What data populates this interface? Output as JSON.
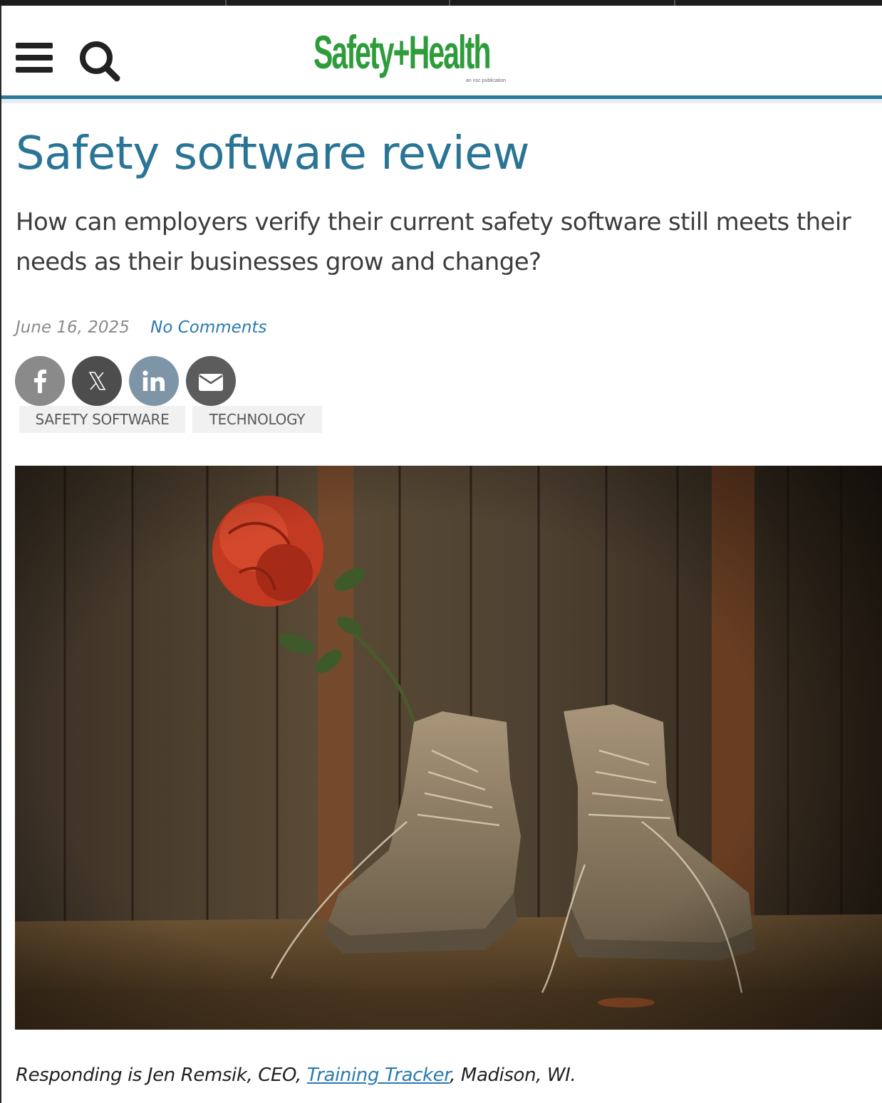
{
  "header": {
    "logo_text": "Safety+Health",
    "logo_subtitle": "an nsc publication"
  },
  "article": {
    "title": "Safety software review",
    "dek": "How can employers verify their current safety software still meets their needs as their businesses grow and change?",
    "date": "June 16, 2025",
    "comments_label": "No Comments",
    "tags": [
      "SAFETY SOFTWARE",
      "TECHNOLOGY"
    ],
    "caption": {
      "prefix": "Responding is Jen Remsik, CEO, ",
      "link_text": "Training Tracker",
      "suffix": ", Madison, WI."
    }
  },
  "share": [
    {
      "name": "facebook",
      "icon": "facebook-icon",
      "color": "#8a8a8a"
    },
    {
      "name": "x",
      "icon": "x-icon",
      "color": "#4d4d4d"
    },
    {
      "name": "linkedin",
      "icon": "linkedin-icon",
      "color": "#7e95a8"
    },
    {
      "name": "email",
      "icon": "email-icon",
      "color": "#5c5c5c"
    }
  ],
  "colors": {
    "brand_green": "#2e9c3a",
    "title_blue": "#2a7595",
    "link_blue": "#2a7ab0",
    "rule_blue": "#2b7a9a"
  }
}
